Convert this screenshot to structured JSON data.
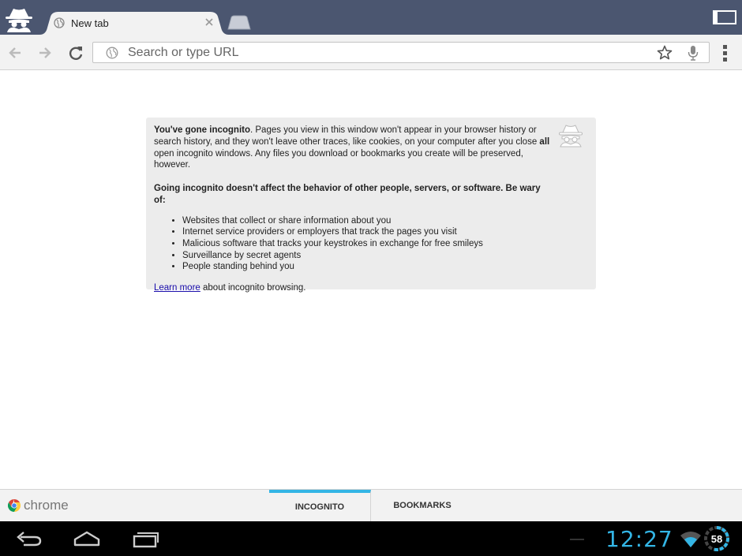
{
  "tab": {
    "title": "New tab"
  },
  "omnibox": {
    "placeholder": "Search or type URL"
  },
  "info": {
    "intro_bold": "You've gone incognito",
    "intro_1": ". Pages you view in this window won't appear in your browser history or search history, and they won't leave other traces, like cookies, on your computer after you close ",
    "intro_all": "all",
    "intro_2": " open incognito windows. Any files you download or bookmarks you create will be preserved, however.",
    "warning": "Going incognito doesn't affect the behavior of other people, servers, or software. Be wary of:",
    "items": [
      "Websites that collect or share information about you",
      "Internet service providers or employers that track the pages you visit",
      "Malicious software that tracks your keystrokes in exchange for free smileys",
      "Surveillance by secret agents",
      "People standing behind you"
    ],
    "learn_link": "Learn more",
    "learn_rest": " about incognito browsing."
  },
  "bottom": {
    "brand": "chrome",
    "tabs": [
      {
        "label": "INCOGNITO",
        "active": true
      },
      {
        "label": "BOOKMARKS",
        "active": false
      }
    ]
  },
  "system": {
    "clock": "12:27",
    "battery": "58"
  },
  "colors": {
    "accent": "#33b5e5",
    "tabstrip": "#4b5670",
    "link": "#1a0dab"
  }
}
